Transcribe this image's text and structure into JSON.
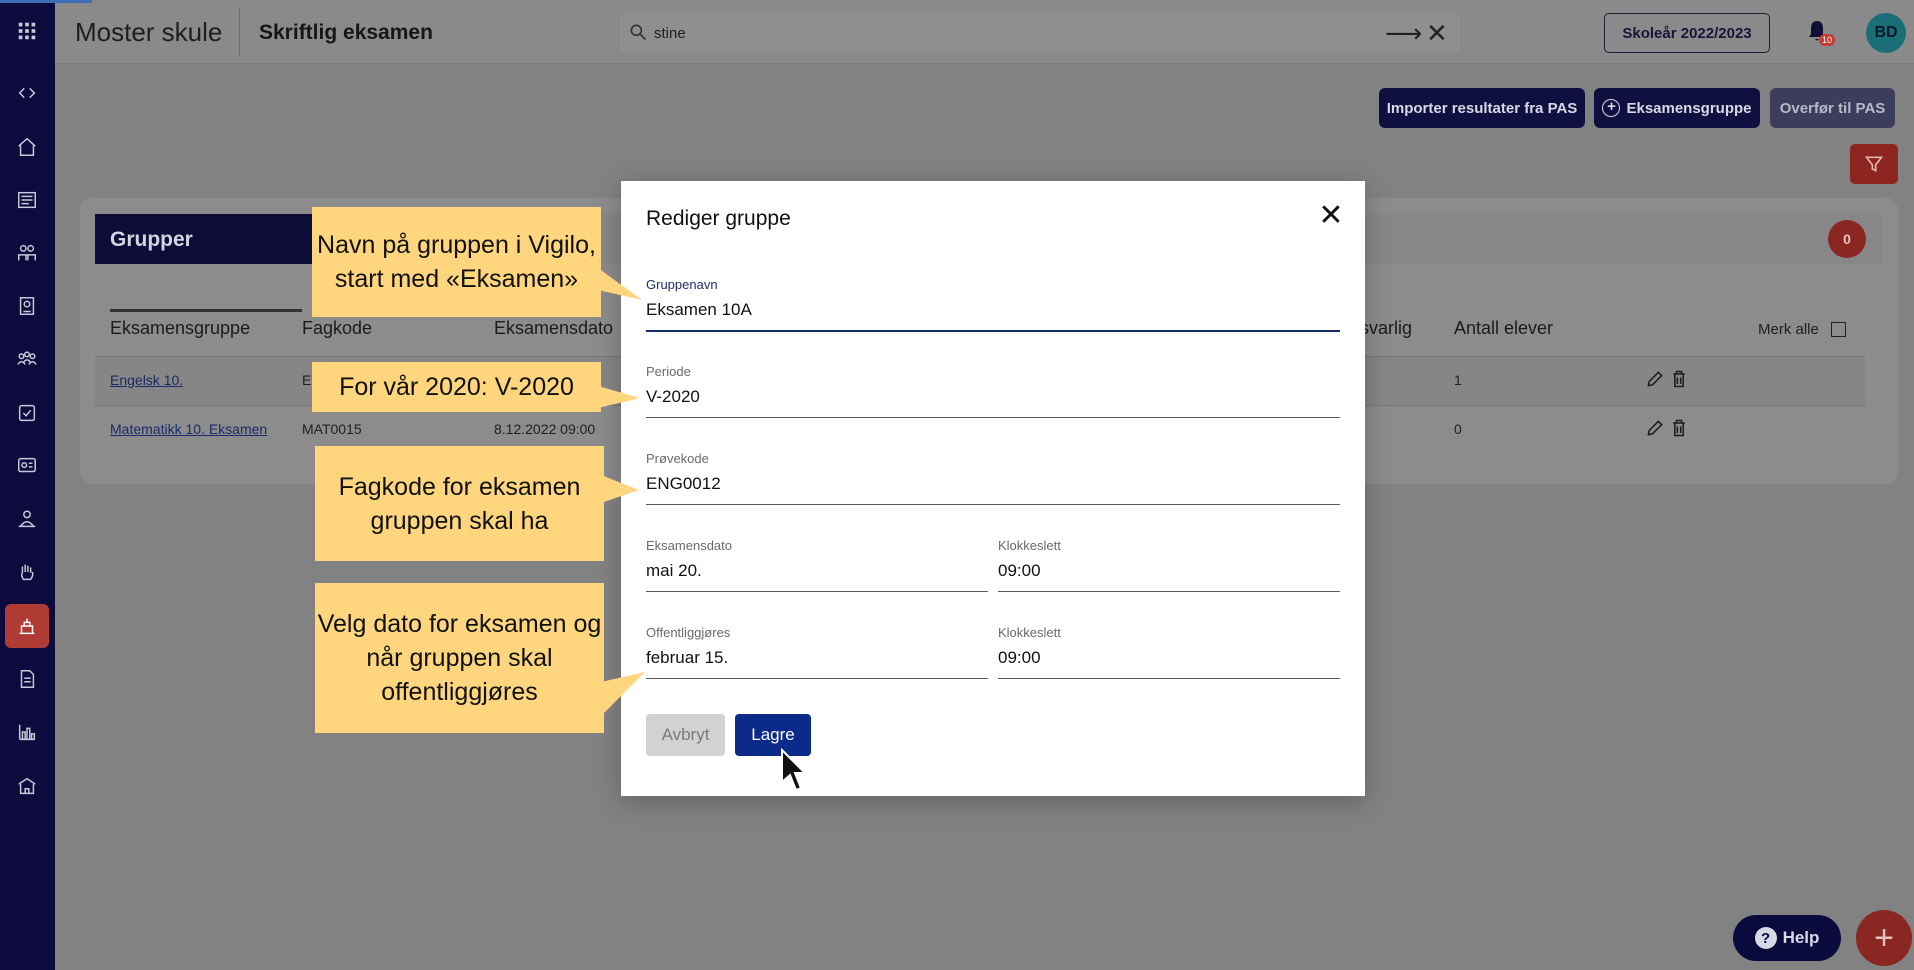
{
  "topbar": {
    "school": "Moster skule",
    "page_title": "Skriftlig eksamen",
    "search_value": "stine",
    "school_year": "Skoleår 2022/2023",
    "notification_count": "10",
    "avatar_initials": "BD"
  },
  "sidebar": {
    "items": [
      "expand-icon",
      "home-icon",
      "news-icon",
      "groups-icon",
      "badge-icon",
      "people-icon",
      "tasks-icon",
      "classroom-icon",
      "person-icon",
      "hand-icon",
      "exam-icon",
      "document-icon",
      "chart-icon",
      "school-icon"
    ],
    "active": "exam-icon"
  },
  "actions": {
    "import": "Importer resultater fra PAS",
    "new_group": "Eksamensgruppe",
    "transfer": "Overfør til PAS"
  },
  "groups_panel": {
    "title": "Grupper",
    "badge": "0",
    "columns": [
      "Eksamensgruppe",
      "Fagkode",
      "Eksamensdato",
      "svarlig",
      "Antall elever"
    ],
    "select_all": "Merk alle",
    "rows": [
      {
        "name": "Engelsk 10.",
        "code": "E",
        "date": "",
        "count": "1"
      },
      {
        "name": "Matematikk 10. Eksamen",
        "code": "MAT0015",
        "date": "8.12.2022  09:00",
        "count": "0"
      }
    ]
  },
  "modal": {
    "title": "Rediger gruppe",
    "fields": {
      "group_name": {
        "label": "Gruppenavn",
        "value": "Eksamen 10A"
      },
      "period": {
        "label": "Periode",
        "value": "V-2020"
      },
      "test_code": {
        "label": "Prøvekode",
        "value": "ENG0012"
      },
      "exam_date": {
        "label": "Eksamensdato",
        "value": "mai 20."
      },
      "exam_time": {
        "label": "Klokkeslett",
        "value": "09:00"
      },
      "publish_date": {
        "label": "Offentliggjøres",
        "value": "februar 15."
      },
      "publish_time": {
        "label": "Klokkeslett",
        "value": "09:00"
      }
    },
    "cancel": "Avbryt",
    "save": "Lagre"
  },
  "callouts": {
    "name": "Navn på gruppen i Vigilo, start med «Eksamen»",
    "period": "For vår 2020: V-2020",
    "code": "Fagkode for eksamen gruppen skal ha",
    "date": "Velg dato for eksamen og når gruppen skal offentliggjøres"
  },
  "help": "Help",
  "colors": {
    "sidebar": "#0d0b3e",
    "primary": "#0b2a8a",
    "callout": "#ffd57e",
    "danger": "#b03a34"
  }
}
